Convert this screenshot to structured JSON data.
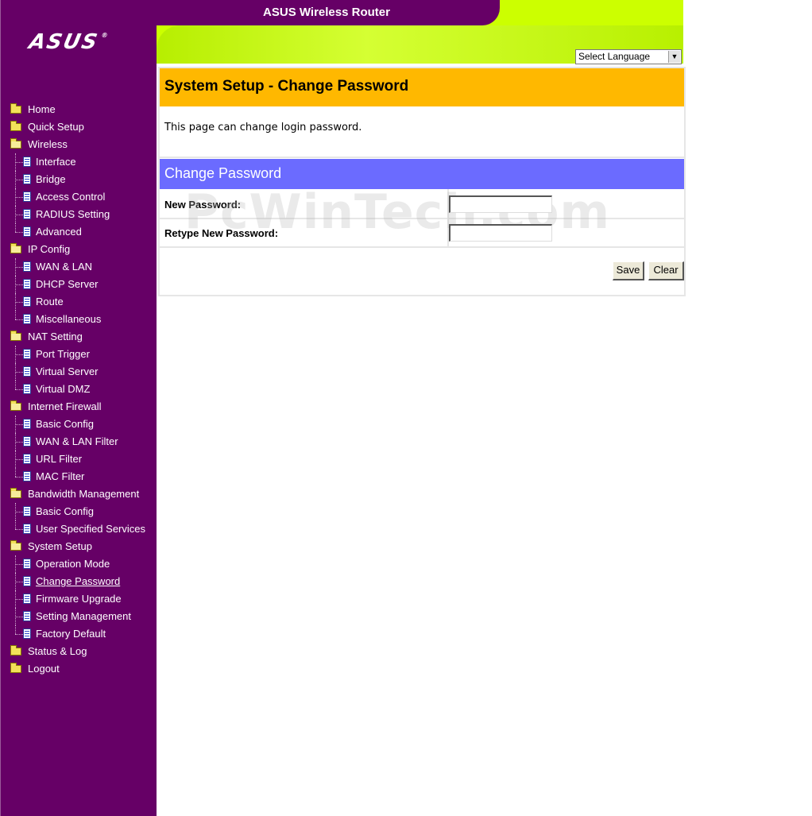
{
  "header": {
    "title": "ASUS Wireless Router",
    "logo": "ASUS",
    "language_select": "Select Language"
  },
  "sidebar": {
    "items": [
      {
        "label": "Home",
        "level": 0,
        "icon": "folder-icon"
      },
      {
        "label": "Quick Setup",
        "level": 0,
        "icon": "folder-icon"
      },
      {
        "label": "Wireless",
        "level": 0,
        "icon": "folder-open-icon"
      },
      {
        "label": "Interface",
        "level": 1,
        "icon": "page-icon"
      },
      {
        "label": "Bridge",
        "level": 1,
        "icon": "page-icon"
      },
      {
        "label": "Access Control",
        "level": 1,
        "icon": "page-icon"
      },
      {
        "label": "RADIUS Setting",
        "level": 1,
        "icon": "page-icon"
      },
      {
        "label": "Advanced",
        "level": 1,
        "icon": "page-icon"
      },
      {
        "label": "IP Config",
        "level": 0,
        "icon": "folder-open-icon"
      },
      {
        "label": "WAN & LAN",
        "level": 1,
        "icon": "page-icon"
      },
      {
        "label": "DHCP Server",
        "level": 1,
        "icon": "page-icon"
      },
      {
        "label": "Route",
        "level": 1,
        "icon": "page-icon"
      },
      {
        "label": "Miscellaneous",
        "level": 1,
        "icon": "page-icon"
      },
      {
        "label": "NAT Setting",
        "level": 0,
        "icon": "folder-open-icon"
      },
      {
        "label": "Port Trigger",
        "level": 1,
        "icon": "page-icon"
      },
      {
        "label": "Virtual Server",
        "level": 1,
        "icon": "page-icon"
      },
      {
        "label": "Virtual DMZ",
        "level": 1,
        "icon": "page-icon"
      },
      {
        "label": "Internet Firewall",
        "level": 0,
        "icon": "folder-open-icon"
      },
      {
        "label": "Basic Config",
        "level": 1,
        "icon": "page-icon"
      },
      {
        "label": "WAN & LAN Filter",
        "level": 1,
        "icon": "page-icon"
      },
      {
        "label": "URL Filter",
        "level": 1,
        "icon": "page-icon"
      },
      {
        "label": "MAC Filter",
        "level": 1,
        "icon": "page-icon"
      },
      {
        "label": "Bandwidth Management",
        "level": 0,
        "icon": "folder-open-icon"
      },
      {
        "label": "Basic Config",
        "level": 1,
        "icon": "page-icon"
      },
      {
        "label": "User Specified Services",
        "level": 1,
        "icon": "page-icon"
      },
      {
        "label": "System Setup",
        "level": 0,
        "icon": "folder-open-icon"
      },
      {
        "label": "Operation Mode",
        "level": 1,
        "icon": "page-icon"
      },
      {
        "label": "Change Password",
        "level": 1,
        "icon": "page-icon",
        "current": true
      },
      {
        "label": "Firmware Upgrade",
        "level": 1,
        "icon": "page-icon"
      },
      {
        "label": "Setting Management",
        "level": 1,
        "icon": "page-icon"
      },
      {
        "label": "Factory Default",
        "level": 1,
        "icon": "page-icon"
      },
      {
        "label": "Status & Log",
        "level": 0,
        "icon": "folder-icon"
      },
      {
        "label": "Logout",
        "level": 0,
        "icon": "folder-icon"
      }
    ]
  },
  "main": {
    "page_title": "System Setup - Change Password",
    "description": "This page can change login password.",
    "section_title": "Change Password",
    "fields": {
      "new_password_label": "New Password:",
      "new_password_value": "",
      "retype_password_label": "Retype New Password:",
      "retype_password_value": ""
    },
    "buttons": {
      "save": "Save",
      "clear": "Clear"
    }
  },
  "watermark": "PcWinTech.com",
  "colors": {
    "sidebar": "#660066",
    "header_green": "#ccff00",
    "title_bar": "#ffb800",
    "section_bar": "#6b6bff"
  }
}
